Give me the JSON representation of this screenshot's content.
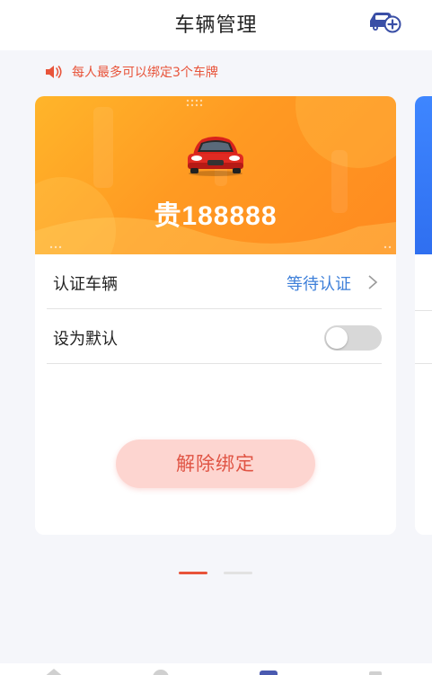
{
  "header": {
    "title": "车辆管理",
    "add_icon": "car-plus-icon"
  },
  "notice": {
    "icon": "speaker-icon",
    "text": "每人最多可以绑定3个车牌",
    "color": "#e8543a"
  },
  "vehicle_card": {
    "plate": "贵188888",
    "car_icon": "red-car-icon",
    "banner_color": "#ff9a22",
    "certify_label": "认证车辆",
    "certify_status": "等待认证",
    "default_label": "设为默认",
    "default_on": false,
    "unbind_label": "解除绑定"
  },
  "pagination": {
    "current": 1,
    "total": 2
  },
  "colors": {
    "accent": "#e8543a",
    "link": "#3d7fd9",
    "next_card": "#2f6ff0"
  }
}
